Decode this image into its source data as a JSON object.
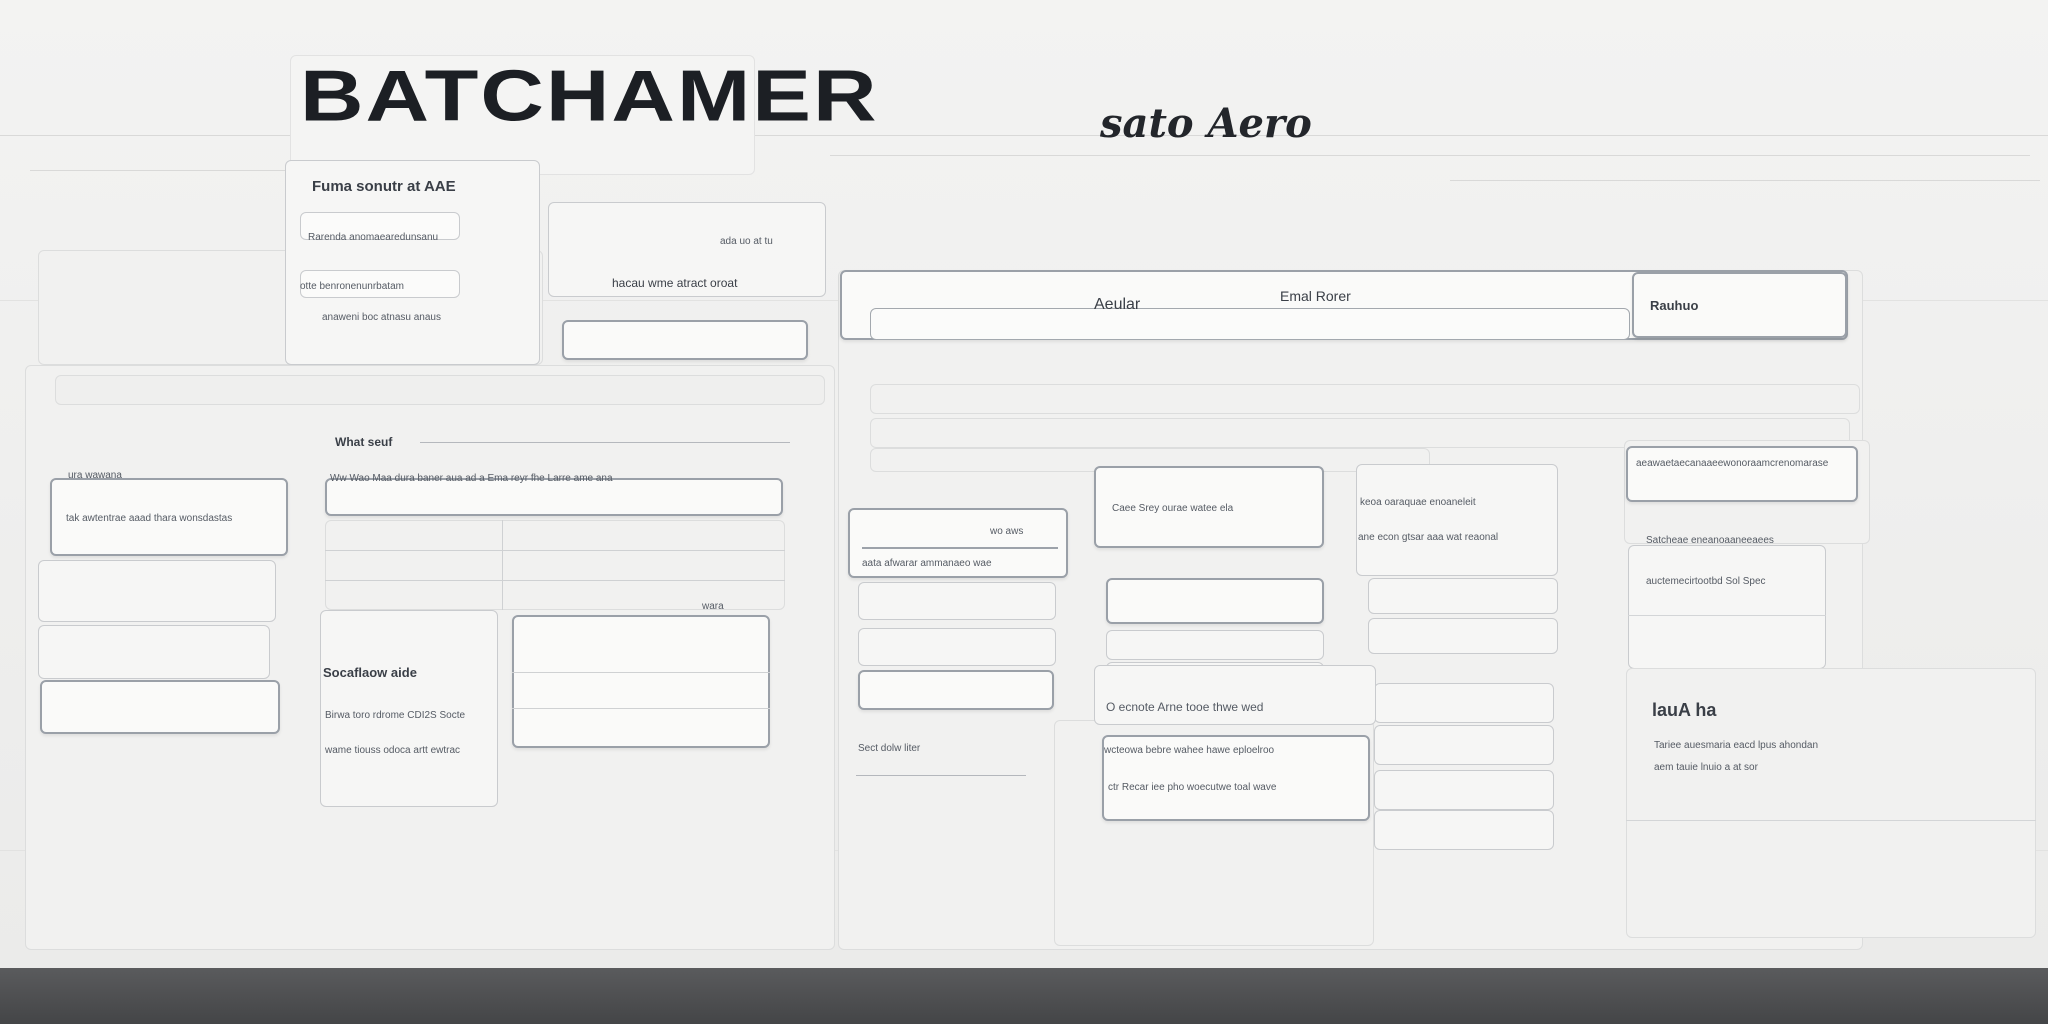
{
  "header": {
    "title": "BATCHAMER",
    "subtitle": "sato Aero"
  },
  "left_panel": {
    "heading": "Fuma sonutr at AAE",
    "rows": [
      "Rarenda   anomaearedunsanu",
      "otte benronenunrbatam",
      "anaweni boc atnasu anaus"
    ]
  },
  "top_mid_card": {
    "caption": "ada uo at tu",
    "line": "hacau wme atract oroat"
  },
  "center_section": {
    "heading": "What seuf",
    "row_text": "Ww Wao Maa dura baner aua ad a Ema reyr fhe Larre ame ana"
  },
  "left_list": {
    "label": "ura wawana",
    "card_text": "tak awtentrae aaad thara wonsdastas"
  },
  "bottom_left_card": {
    "label": "Socaflaow aide",
    "lines": [
      "Birwa toro rdrome CDI2S Socte",
      "wame tiouss odoca artt ewtrac"
    ],
    "corner_tag": "wara"
  },
  "main_panel": {
    "tab_left": "Aeular",
    "tab_center": "Emal Rorer",
    "tab_right": "Rauhuo"
  },
  "mid_card_a": {
    "caption": "wo aws",
    "footer": "aata afwarar ammanaeo wae"
  },
  "mid_card_b": {
    "text": "Caee Srey ourae watee ela"
  },
  "mid_card_c": {
    "lines": [
      "keoa oaraquae enoaneleit",
      "ane econ gtsar aaa wat reaonal"
    ]
  },
  "right_column": {
    "top_line": "aeawaetaecanaaeewonoraamcrenomarase",
    "label": "Satcheae eneanoaaneeaees",
    "sub": "auctemecirtootbd Sol Spec"
  },
  "bottom_mid": {
    "side_label": "Sect dolw liter",
    "title_line": "O ecnote   Arne  tooe  thwe wed",
    "lines": [
      "wcteowa bebre wahee hawe eploelroo",
      "ctr Recar iee pho woecutwe toal wave"
    ]
  },
  "bottom_right": {
    "heading": "lauA ha",
    "lines": [
      "Tariee auesmaria eacd  lpus ahondan",
      "aem tauie lnuio a at sor"
    ]
  }
}
